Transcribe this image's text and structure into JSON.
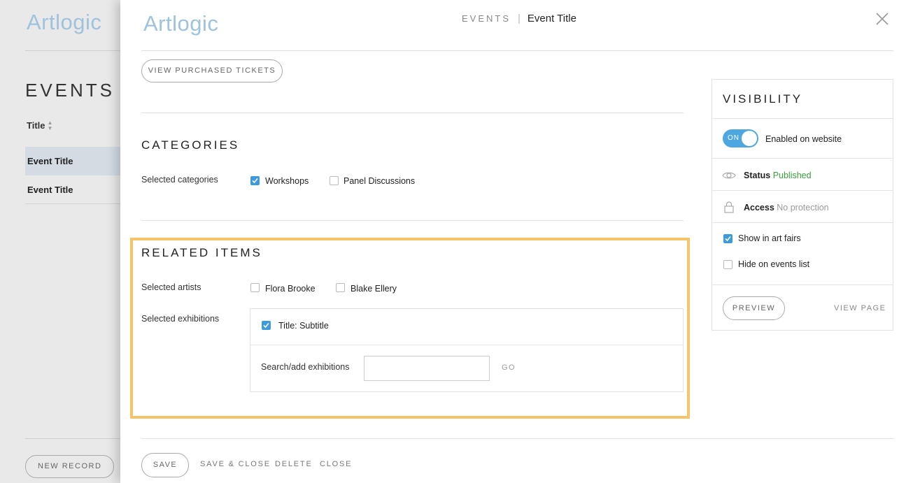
{
  "background": {
    "logo": "Artlogic",
    "page_title": "EVENTS",
    "column_title": "Title",
    "rows": [
      "Event Title",
      "Event Title"
    ],
    "new_record": "NEW RECORD"
  },
  "modal": {
    "logo": "Artlogic",
    "breadcrumb": {
      "section": "EVENTS",
      "title": "Event Title"
    },
    "view_tickets": "VIEW PURCHASED TICKETS",
    "categories": {
      "heading": "CATEGORIES",
      "label": "Selected categories",
      "options": [
        {
          "label": "Workshops",
          "checked": true
        },
        {
          "label": "Panel Discussions",
          "checked": false
        }
      ]
    },
    "related": {
      "heading": "RELATED ITEMS",
      "artists_label": "Selected artists",
      "artists": [
        {
          "label": "Flora Brooke",
          "checked": false
        },
        {
          "label": "Blake Ellery",
          "checked": false
        }
      ],
      "exhibitions_label": "Selected exhibitions",
      "exhibitions": [
        {
          "label": "Title: Subtitle",
          "checked": true
        }
      ],
      "search_label": "Search/add exhibitions",
      "search_value": "",
      "go": "GO"
    },
    "visibility": {
      "heading": "VISIBILITY",
      "toggle_text": "ON",
      "enabled_label": "Enabled on website",
      "status_label": "Status",
      "status_value": "Published",
      "access_label": "Access",
      "access_value": "No protection",
      "show_art_fairs": {
        "label": "Show in art fairs",
        "checked": true
      },
      "hide_events": {
        "label": "Hide on events list",
        "checked": false
      },
      "preview": "PREVIEW",
      "view_page": "VIEW PAGE"
    },
    "footer": {
      "save": "SAVE",
      "save_close": "SAVE & CLOSE",
      "delete": "DELETE",
      "close": "CLOSE"
    }
  },
  "colors": {
    "accent": "#3d9bdb",
    "highlight": "#f6c56a",
    "published": "#3aa13a",
    "logo": "#9fc2dd"
  }
}
